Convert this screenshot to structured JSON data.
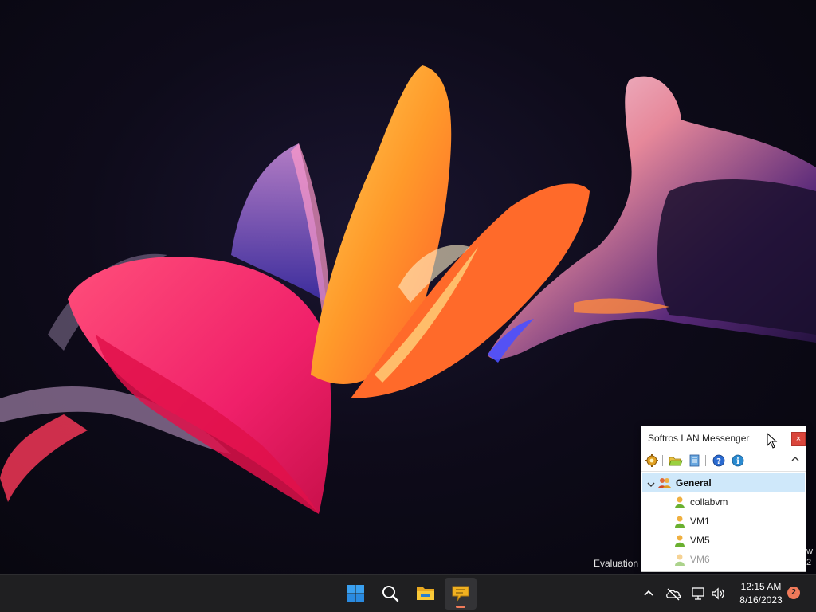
{
  "desktop": {
    "watermark": {
      "evaluation_text": "Evaluation",
      "edge_char_top": "w",
      "edge_char_bottom": "2"
    }
  },
  "messenger": {
    "title": "Softros LAN Messenger",
    "close_label": "×",
    "collapse_label": "^",
    "toolbar": {
      "settings_icon": "gear-icon",
      "open_icon": "folder-open-icon",
      "history_icon": "message-history-icon",
      "help_icon": "help-icon",
      "about_icon": "info-icon"
    },
    "group": {
      "label": "General",
      "expanded": true
    },
    "users": [
      {
        "name": "collabvm",
        "online": true
      },
      {
        "name": "VM1",
        "online": true
      },
      {
        "name": "VM5",
        "online": true
      },
      {
        "name": "VM6",
        "online": false
      }
    ]
  },
  "taskbar": {
    "apps": [
      "windows-start-icon",
      "search-icon",
      "file-explorer-icon",
      "lan-messenger-icon"
    ],
    "tray": [
      "chevron-up-icon",
      "onedrive-icon",
      "network-icon",
      "volume-icon"
    ],
    "clock": {
      "time": "12:15 AM",
      "date": "8/16/2023"
    },
    "notification_count": "2"
  },
  "colors": {
    "accent": "#f07a5a",
    "taskbar": "#1f1f21",
    "selection": "#cfe8fa",
    "close_button": "#d9453b"
  }
}
